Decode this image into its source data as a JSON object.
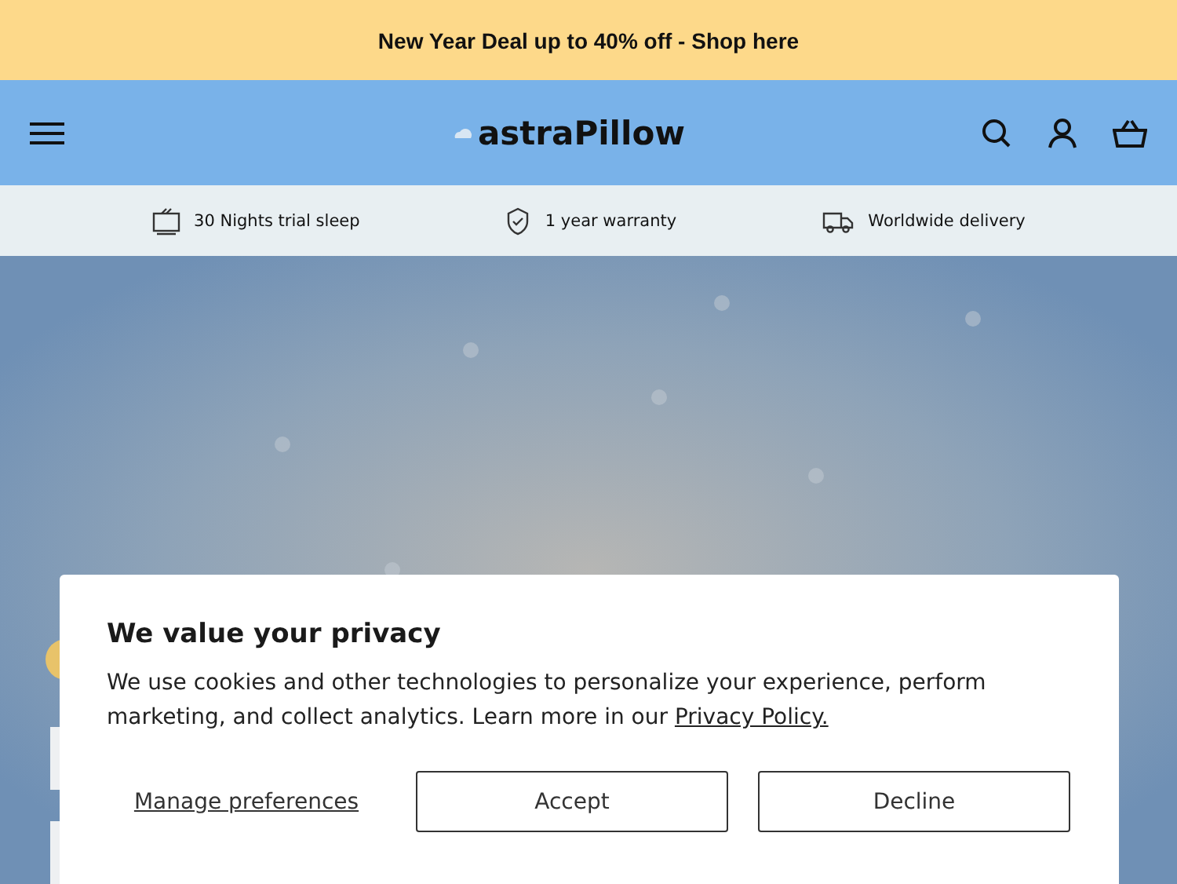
{
  "announcement": "New Year Deal up to 40% off  - Shop here",
  "header": {
    "logo": "astraPillow"
  },
  "features": [
    {
      "kind": "tv",
      "label": "30 Nights trial sleep"
    },
    {
      "kind": "shield",
      "label": "1 year warranty"
    },
    {
      "kind": "truck",
      "label": "Worldwide delivery"
    }
  ],
  "cookie_dialog": {
    "title": "We value your privacy",
    "text": "We use cookies and other technologies to personalize your experience, perform marketing, and collect analytics. Learn more in our ",
    "link": "Privacy Policy.",
    "manage": "Manage preferences",
    "buttons": [
      "Accept",
      "Decline"
    ]
  }
}
